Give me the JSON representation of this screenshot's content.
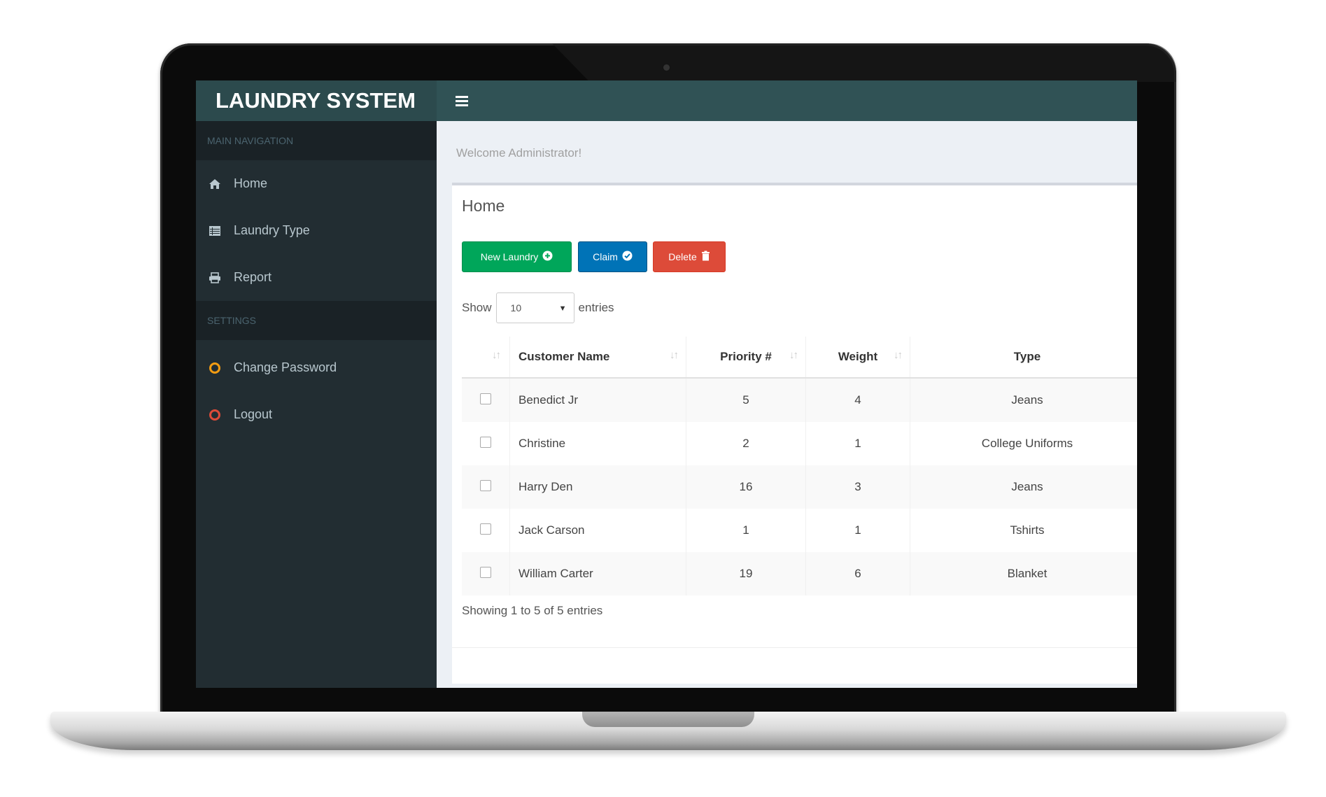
{
  "app": {
    "title": "LAUNDRY SYSTEM"
  },
  "header": {
    "menu_icon": "hamburger-icon"
  },
  "sidebar": {
    "sections": [
      {
        "header": "MAIN NAVIGATION",
        "items": [
          {
            "label": "Home",
            "icon": "home-icon"
          },
          {
            "label": "Laundry Type",
            "icon": "table-icon"
          },
          {
            "label": "Report",
            "icon": "printer-icon"
          }
        ]
      },
      {
        "header": "SETTINGS",
        "items": [
          {
            "label": "Change Password",
            "icon": "circle-icon",
            "color": "#f39c12"
          },
          {
            "label": "Logout",
            "icon": "circle-icon",
            "color": "#dd4b39"
          }
        ]
      }
    ]
  },
  "main": {
    "welcome": "Welcome Administrator!",
    "title": "Home",
    "buttons": {
      "new_laundry": "New Laundry",
      "claim": "Claim",
      "delete": "Delete"
    },
    "length": {
      "show": "Show",
      "value": "10",
      "entries": "entries"
    },
    "table": {
      "headers": [
        "",
        "Customer Name",
        "Priority #",
        "Weight",
        "Type"
      ],
      "rows": [
        {
          "name": "Benedict Jr",
          "priority": "5",
          "weight": "4",
          "type": "Jeans"
        },
        {
          "name": "Christine",
          "priority": "2",
          "weight": "1",
          "type": "College Uniforms"
        },
        {
          "name": "Harry Den",
          "priority": "16",
          "weight": "3",
          "type": "Jeans"
        },
        {
          "name": "Jack Carson",
          "priority": "1",
          "weight": "1",
          "type": "Tshirts"
        },
        {
          "name": "William Carter",
          "priority": "19",
          "weight": "6",
          "type": "Blanket"
        }
      ]
    },
    "info": "Showing 1 to 5 of 5 entries"
  },
  "colors": {
    "header": "#305255",
    "sidebar": "#222d32",
    "success": "#00a65a",
    "primary": "#0073b7",
    "danger": "#dd4b39"
  }
}
